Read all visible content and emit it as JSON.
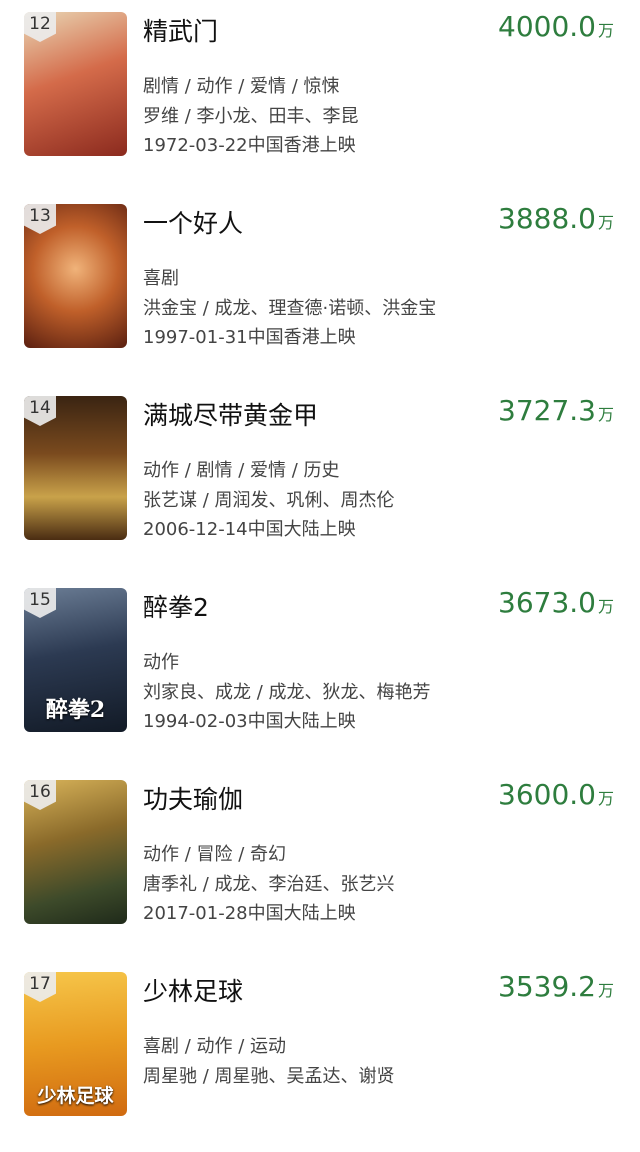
{
  "movies": [
    {
      "rank": "12",
      "title": "精武门",
      "box_value": "4000.0",
      "box_unit": "万",
      "genre": "剧情 / 动作 / 爱情 / 惊悚",
      "cast": "罗维 / 李小龙、田丰、李昆",
      "release": "1972-03-22中国香港上映",
      "poster_caption": ""
    },
    {
      "rank": "13",
      "title": "一个好人",
      "box_value": "3888.0",
      "box_unit": "万",
      "genre": "喜剧",
      "cast": "洪金宝 / 成龙、理查德·诺顿、洪金宝",
      "release": "1997-01-31中国香港上映",
      "poster_caption": ""
    },
    {
      "rank": "14",
      "title": "满城尽带黄金甲",
      "box_value": "3727.3",
      "box_unit": "万",
      "genre": "动作 / 剧情 / 爱情 / 历史",
      "cast": "张艺谋 / 周润发、巩俐、周杰伦",
      "release": "2006-12-14中国大陆上映",
      "poster_caption": ""
    },
    {
      "rank": "15",
      "title": "醉拳2",
      "box_value": "3673.0",
      "box_unit": "万",
      "genre": "动作",
      "cast": "刘家良、成龙 / 成龙、狄龙、梅艳芳",
      "release": "1994-02-03中国大陆上映",
      "poster_caption": "醉拳2"
    },
    {
      "rank": "16",
      "title": "功夫瑜伽",
      "box_value": "3600.0",
      "box_unit": "万",
      "genre": "动作 / 冒险 / 奇幻",
      "cast": "唐季礼 / 成龙、李治廷、张艺兴",
      "release": "2017-01-28中国大陆上映",
      "poster_caption": ""
    },
    {
      "rank": "17",
      "title": "少林足球",
      "box_value": "3539.2",
      "box_unit": "万",
      "genre": "喜剧 / 动作 / 运动",
      "cast": "周星驰 / 周星驰、吴孟达、谢贤",
      "release": "",
      "poster_caption": "少林足球"
    }
  ],
  "colors": {
    "box_office": "#2e7d3e",
    "posters": [
      "#c8553d",
      "#a8441f",
      "#5b3a22",
      "#233044",
      "#6e5a2a",
      "#e0a020"
    ]
  }
}
